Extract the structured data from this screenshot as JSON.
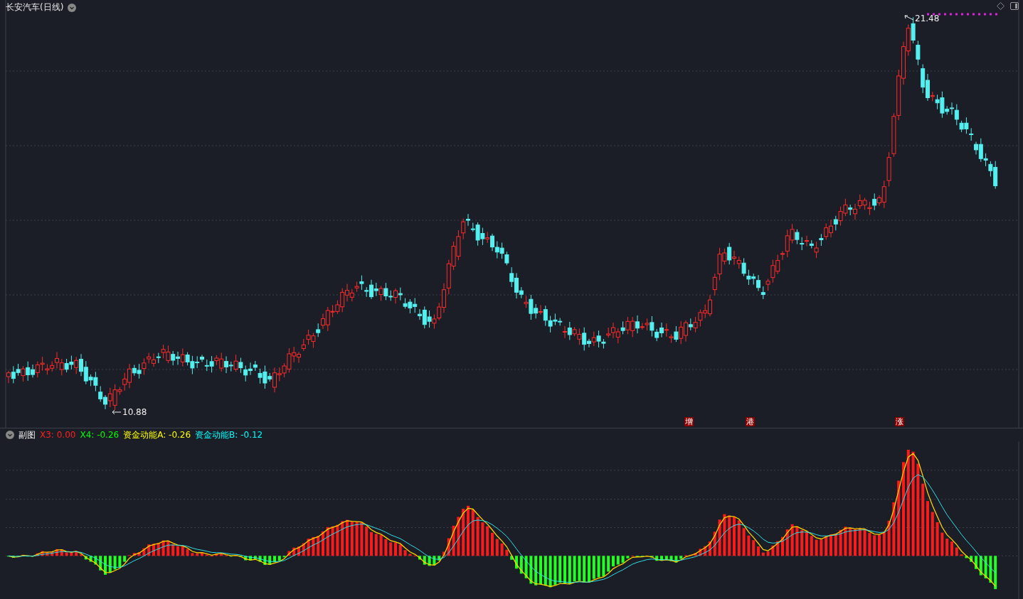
{
  "title": "长安汽车(日线)",
  "price_chart": {
    "high_label": "21.48",
    "low_label": "10.88"
  },
  "signals": [
    {
      "label": "增"
    },
    {
      "label": "港"
    },
    {
      "label": "涨"
    }
  ],
  "sub_chart": {
    "title": "副图",
    "legend": [
      {
        "label": "X3: 0.00",
        "color": "#ff2020"
      },
      {
        "label": "X4: -0.26",
        "color": "#00ff00"
      },
      {
        "label": "资金动能A: -0.26",
        "color": "#ffff00"
      },
      {
        "label": "资金动能B: -0.12",
        "color": "#00ffff"
      }
    ]
  }
}
